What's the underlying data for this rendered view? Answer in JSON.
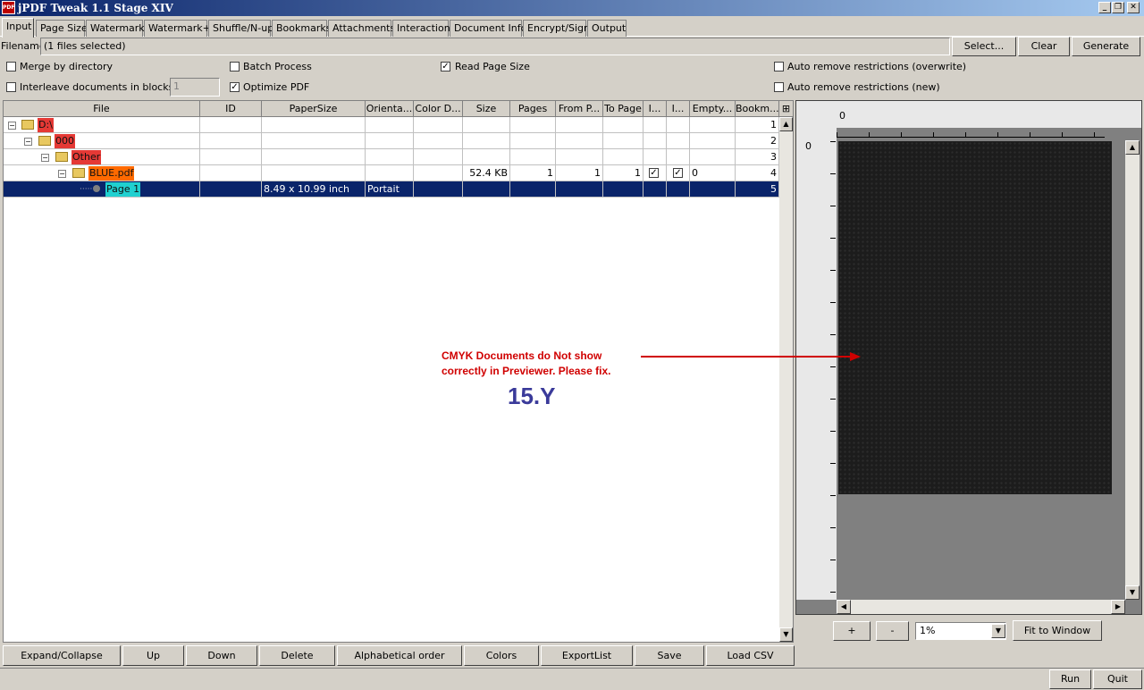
{
  "window": {
    "title": "jPDF Tweak 1.1 Stage XIV",
    "app_icon_label": "PDF",
    "minimize": "_",
    "maximize": "❐",
    "close": "✕"
  },
  "tabs": [
    "Input",
    "Page Size",
    "Watermark",
    "Watermark+",
    "Shuffle/N-up",
    "Bookmarks",
    "Attachments",
    "Interaction",
    "Document Info",
    "Encrypt/Sign",
    "Output"
  ],
  "filename": {
    "label": "Filename",
    "value": "(1 files selected)",
    "select": "Select...",
    "clear": "Clear",
    "generate": "Generate"
  },
  "options": {
    "merge_by_directory": {
      "label": "Merge by directory",
      "checked": false
    },
    "batch_process": {
      "label": "Batch Process",
      "checked": false
    },
    "read_page_size": {
      "label": "Read Page Size",
      "checked": true
    },
    "auto_remove_overwrite": {
      "label": "Auto remove restrictions (overwrite)",
      "checked": false
    },
    "interleave": {
      "label": "Interleave documents in blocks of",
      "checked": false,
      "value": "1"
    },
    "optimize_pdf": {
      "label": "Optimize PDF",
      "checked": true
    },
    "auto_remove_new": {
      "label": "Auto remove restrictions (new)",
      "checked": false
    }
  },
  "table": {
    "columns": [
      "File",
      "ID",
      "PaperSize",
      "Orienta...",
      "Color D...",
      "Size",
      "Pages",
      "From P...",
      "To Page",
      "I...",
      "I...",
      "Empty...",
      "Bookm..."
    ],
    "rows": [
      {
        "file": "D:\\",
        "id": "",
        "paper": "",
        "orient": "",
        "color": "",
        "size": "",
        "pages": "",
        "from": "",
        "to": "",
        "i1": "",
        "i2": "",
        "empty": "",
        "bookm": "1"
      },
      {
        "file": "000",
        "id": "",
        "paper": "",
        "orient": "",
        "color": "",
        "size": "",
        "pages": "",
        "from": "",
        "to": "",
        "i1": "",
        "i2": "",
        "empty": "",
        "bookm": "2"
      },
      {
        "file": "Other",
        "id": "",
        "paper": "",
        "orient": "",
        "color": "",
        "size": "",
        "pages": "",
        "from": "",
        "to": "",
        "i1": "",
        "i2": "",
        "empty": "",
        "bookm": "3"
      },
      {
        "file": "BLUE.pdf",
        "id": "",
        "paper": "",
        "orient": "",
        "color": "",
        "size": "52.4 KB",
        "pages": "1",
        "from": "1",
        "to": "1",
        "i1": "✓",
        "i2": "✓",
        "empty": "0",
        "bookm": "4"
      },
      {
        "file": "Page 1",
        "id": "",
        "paper": "8.49 x 10.99 inch",
        "orient": "Portait",
        "color": "",
        "size": "",
        "pages": "",
        "from": "",
        "to": "",
        "i1": "",
        "i2": "",
        "empty": "",
        "bookm": "5"
      }
    ]
  },
  "colors": {
    "row_selected": "#0a246a",
    "folder_label": "#e53935",
    "file_label": "#ff6a00",
    "page_label": "#20d0d0",
    "annotation": "#d00000"
  },
  "preview": {
    "ruler_zero_x": "0",
    "ruler_zero_y": "0",
    "zoom_in": "+",
    "zoom_out": "-",
    "zoom": "1%",
    "fit": "Fit to Window"
  },
  "annotation": {
    "line1": "CMYK  Documents do Not  show",
    "line2": "correctly in Previewer. Please fix.",
    "version": "15.Y"
  },
  "bottom_buttons": [
    "Expand/Collapse",
    "Up",
    "Down",
    "Delete",
    "Alphabetical order",
    "Colors",
    "ExportList",
    "Save",
    "Load CSV"
  ],
  "footer": {
    "run": "Run",
    "quit": "Quit"
  }
}
